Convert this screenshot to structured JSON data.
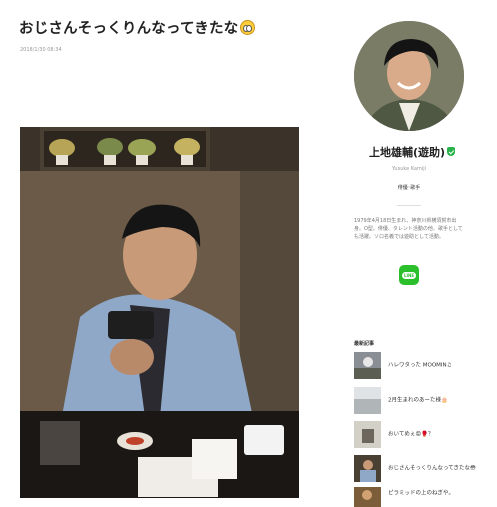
{
  "post": {
    "title": "おじさんそっくりんなってきたな",
    "date": "2018/1/30 08:34"
  },
  "profile": {
    "name": "上地雄輔(遊助)",
    "roman_name": "Yusuke Kamiji",
    "role": "俳優･歌手",
    "bio": "1979年4月18日生まれ、神奈川県横須賀市出身。O型。俳優、タレント活動の他、歌手としても活躍。ソロ名義では遊助として活動。",
    "line_label": "LINE"
  },
  "recent": {
    "heading": "最新記事",
    "items": [
      {
        "label": "ハレワタった MOOMIN♫"
      },
      {
        "label": "2月生まれのあーた様🎂"
      },
      {
        "label": "おいてめぇ😡🥊？"
      },
      {
        "label": "おじさんそっくりんなってきたな😳"
      },
      {
        "label": "ピラミッドの上のねぎや。"
      }
    ]
  },
  "icons": {
    "title_emoji": "flushed-face-icon",
    "verified": "verified-shield-icon",
    "line": "line-app-icon"
  },
  "colors": {
    "line_green": "#2bc02b",
    "verified_green": "#27b34a",
    "date_gray": "#999999"
  }
}
